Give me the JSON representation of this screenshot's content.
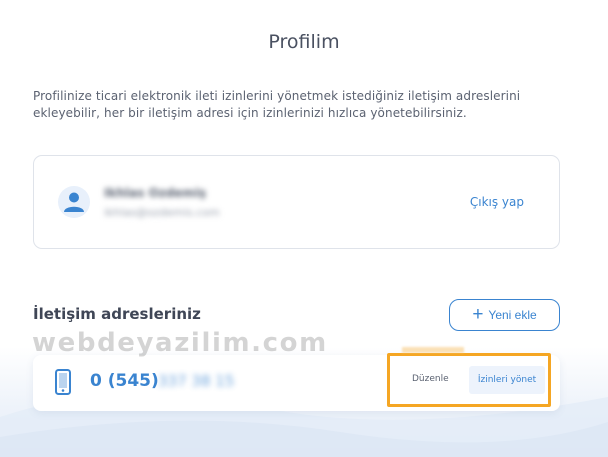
{
  "header": {
    "title": "Profilim"
  },
  "intro": {
    "text": "Profilinize ticari elektronik ileti izinlerini yönetmek istediğiniz iletişim adreslerini ekleyebilir, her bir iletişim adresi için izinlerinizi hızlıca yönetebilirsiniz."
  },
  "account": {
    "name": "Ikhlas Ozdemiş",
    "subtitle": "ikhlas@ozdemis.com",
    "logout_label": "Çıkış yap",
    "avatar_icon": "user-icon"
  },
  "addresses": {
    "title": "İletişim adresleriniz",
    "add_label": "Yeni ekle",
    "add_icon": "plus-icon",
    "items": [
      {
        "icon": "mobile-phone-icon",
        "prefix": "0 (545)",
        "rest": "337 38 15",
        "edit_label": "Düzenle",
        "manage_label": "İzinleri yönet"
      }
    ]
  },
  "watermark": {
    "text": "webdeyazilim.com"
  },
  "colors": {
    "accent": "#3a84d0",
    "highlight": "#f5a623",
    "border": "#dfe3ea"
  }
}
